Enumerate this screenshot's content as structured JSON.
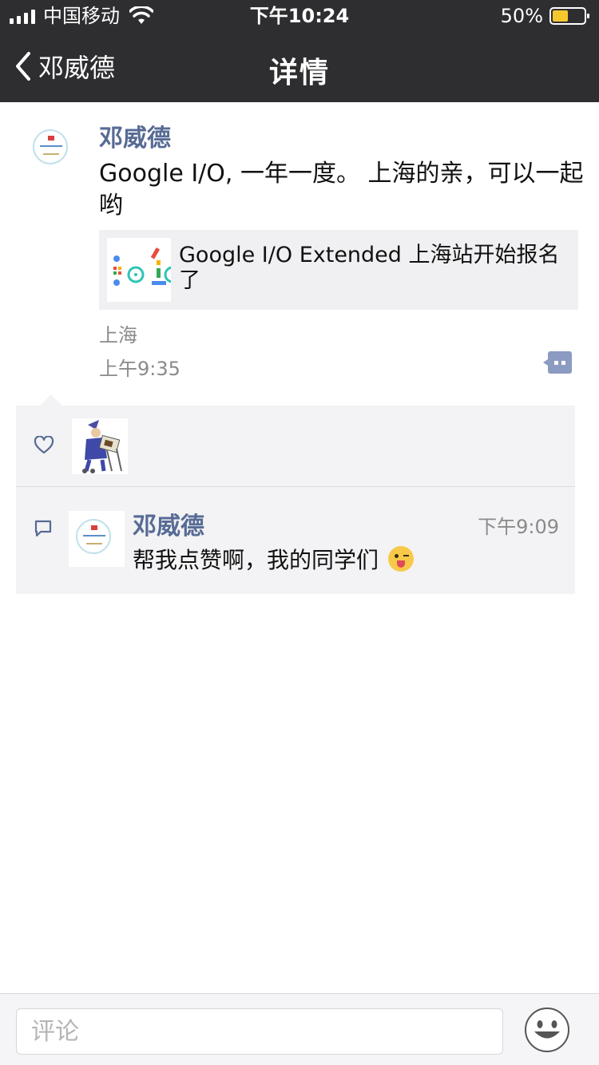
{
  "status_bar": {
    "carrier": "中国移动",
    "time": "下午10:24",
    "battery_percent": "50%",
    "battery_level": 0.5,
    "battery_color": "#f5c72d"
  },
  "nav": {
    "back_label": "邓威德",
    "title": "详情"
  },
  "post": {
    "author": "邓威德",
    "text": "Google I/O, 一年一度。 上海的亲，可以一起哟",
    "link_title": "Google I/O Extended 上海站开始报名了",
    "location": "上海",
    "time": "上午9:35"
  },
  "comments": [
    {
      "author": "邓威德",
      "time": "下午9:09",
      "text": "帮我点赞啊，我的同学们"
    }
  ],
  "bottom_bar": {
    "comment_placeholder": "评论"
  },
  "colors": {
    "header_bg": "#2e2e31",
    "name_link": "#576b95",
    "panel_bg": "#f3f3f5",
    "meta_gray": "#8a8a8a"
  },
  "icons": {
    "back": "chevron-left-icon",
    "wifi": "wifi-icon",
    "signal": "signal-icon",
    "battery": "battery-icon",
    "action": "more-actions-icon",
    "like": "heart-icon",
    "comment": "comment-bubble-icon",
    "emoji": "smiley-icon"
  }
}
